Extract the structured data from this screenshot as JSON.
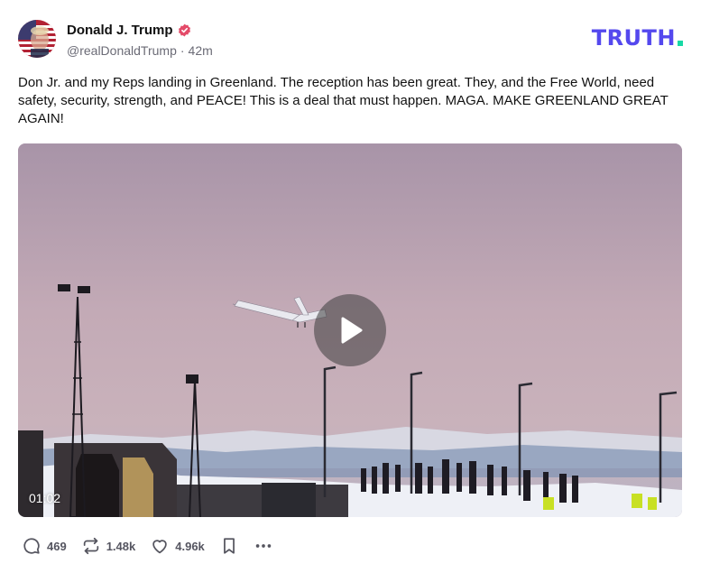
{
  "author": {
    "display_name": "Donald J. Trump",
    "handle": "@realDonaldTrump",
    "separator": "·",
    "time_ago": "42m",
    "verified_color": "#e44b69"
  },
  "brand": {
    "logo_text": "TRUTH",
    "logo_color": "#5448ee",
    "logo_dot_color": "#17d9a5"
  },
  "post": {
    "text": "Don Jr. and my Reps landing in Greenland. The reception has been great. They, and the Free World, need safety, security, strength, and PEACE! This is a deal that must happen. MAGA. MAKE GREENLAND GREAT AGAIN!"
  },
  "video": {
    "duration": "01:02",
    "play_icon": "play-icon"
  },
  "actions": {
    "replies": "469",
    "retruths": "1.48k",
    "likes": "4.96k",
    "icons": [
      "reply-icon",
      "retruth-icon",
      "like-icon",
      "bookmark-icon",
      "more-icon"
    ]
  }
}
